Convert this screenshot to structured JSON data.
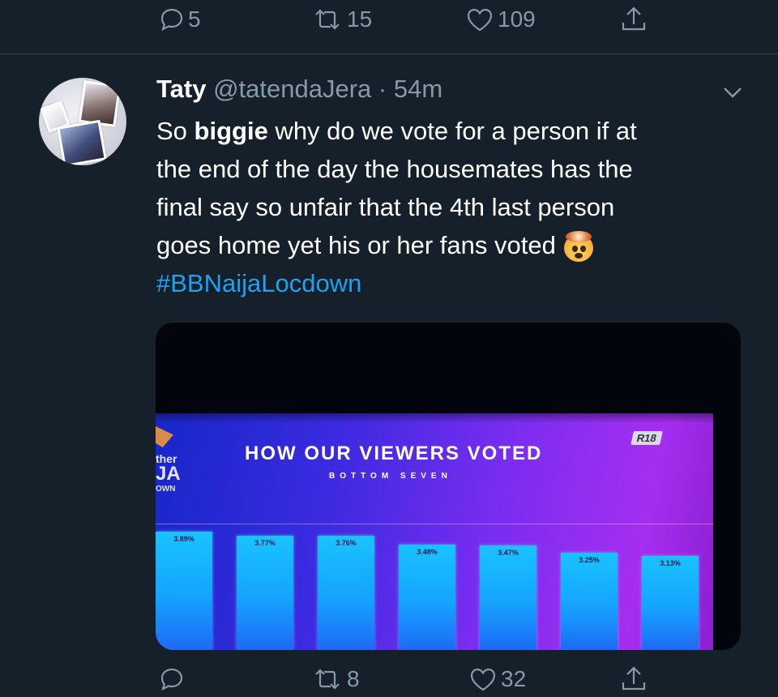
{
  "top_actions": {
    "reply_count": "5",
    "retweet_count": "15",
    "like_count": "109"
  },
  "tweet": {
    "name": "Taty",
    "handle": "@tatendaJera",
    "separator": "·",
    "time": "54m",
    "text_line1_a": "So ",
    "text_line1_b": "biggie",
    "text_line1_c": " why do we vote for a person if at",
    "text_line2": "the end of the day the housemates has the",
    "text_line3": "final say so unfair that  the 4th last person",
    "text_line4": "goes home yet his or her fans voted",
    "hashtag": "#BBNaijaLocdown"
  },
  "media": {
    "side_text": {
      "line1": "ther",
      "line2": "JA",
      "line3": "OWN"
    },
    "rating": "R18"
  },
  "chart_data": {
    "type": "bar",
    "title": "HOW OUR VIEWERS VOTED",
    "subtitle": "BOTTOM SEVEN",
    "data_labels": [
      "3.89%",
      "3.77%",
      "3.76%",
      "3.48%",
      "3.47%",
      "3.25%",
      "3.13%"
    ],
    "values": [
      3.89,
      3.77,
      3.76,
      3.48,
      3.47,
      3.25,
      3.13
    ]
  },
  "bottom_actions": {
    "retweet_count": "8",
    "like_count": "32"
  },
  "colors": {
    "background": "#15202b",
    "muted": "#8899a6",
    "link": "#1da1f2",
    "bar": "#19c3ff"
  },
  "icons": [
    "reply-icon",
    "retweet-icon",
    "like-icon",
    "share-icon",
    "chevron-down-icon"
  ]
}
